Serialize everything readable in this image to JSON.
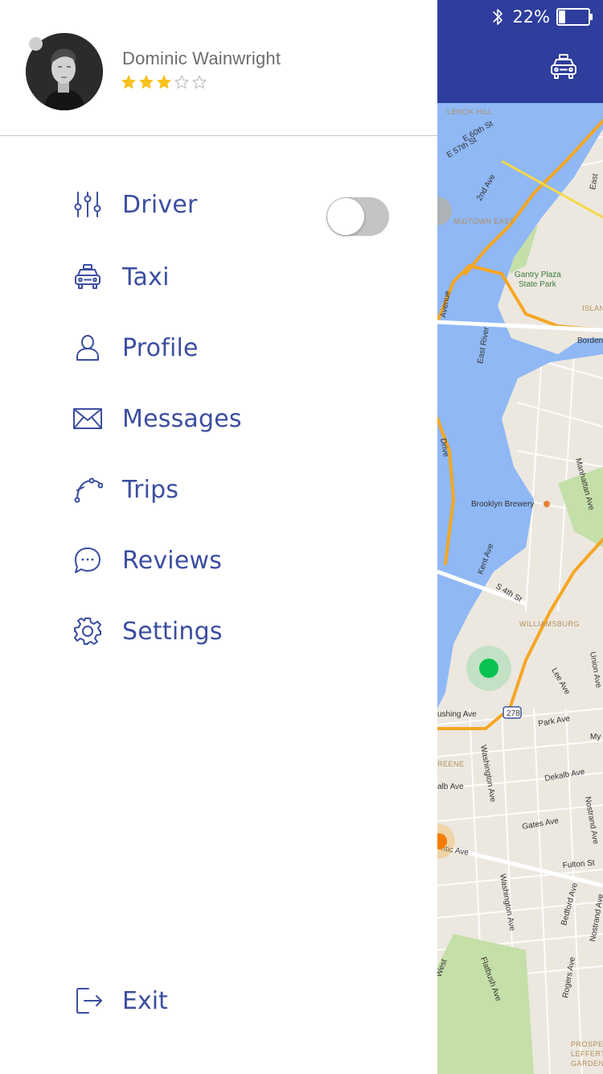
{
  "status_bar": {
    "battery_percent": "22%",
    "battery_level": 0.22
  },
  "user": {
    "name": "Dominic Wainwright",
    "rating": 3,
    "rating_max": 5,
    "star_color": "#f8c21c"
  },
  "menu": {
    "driver": {
      "label": "Driver",
      "icon": "sliders-icon",
      "toggle_on": false
    },
    "taxi": {
      "label": "Taxi",
      "icon": "taxi-icon"
    },
    "profile": {
      "label": "Profile",
      "icon": "person-icon"
    },
    "messages": {
      "label": "Messages",
      "icon": "envelope-icon"
    },
    "trips": {
      "label": "Trips",
      "icon": "route-icon"
    },
    "reviews": {
      "label": "Reviews",
      "icon": "chat-bubble-icon"
    },
    "settings": {
      "label": "Settings",
      "icon": "gear-icon"
    }
  },
  "exit": {
    "label": "Exit",
    "icon": "exit-icon"
  },
  "map": {
    "labels": {
      "e60": "E 60th St",
      "e57": "E 57th St",
      "ave2": "2nd Ave",
      "midtown": "MIDTOWN EAST",
      "gantry1": "Gantry Plaza",
      "gantry2": "State Park",
      "island": "ISLAN",
      "east_river": "East River",
      "borden": "Borden",
      "avenue": "Avenue",
      "drive": "Drive",
      "manhattan_ave": "Manhattan Ave",
      "brewery": "Brooklyn Brewery",
      "kent": "Kent Ave",
      "s4th": "S 4th St",
      "williamsburg": "WILLIAMSBURG",
      "lee": "Lee Ave",
      "union": "Union Ave",
      "i278": "278",
      "flushing": "ushing Ave",
      "park": "Park Ave",
      "my": "My",
      "greene": "REENE",
      "dekalb_left": "alb Ave",
      "washington": "Washington Ave",
      "dekalb": "Dekalb Ave",
      "nostrand": "Nostrand Ave",
      "gates": "Gates Ave",
      "atlantic": "ntic Ave",
      "fulton": "Fulton St",
      "washington2": "Washington Ave",
      "bedford": "Bedford Ave",
      "nostrand2": "Nostrand Ave",
      "west": "West",
      "flatbush": "Flatbush Ave",
      "rogers": "Rogers Ave",
      "prospect1": "PROSPEC",
      "prospect2": "LEFFERT",
      "prospect3": "GARDEN",
      "east": "East",
      "lexington": "LENOX HILL"
    },
    "colors": {
      "water": "#8fb8f5",
      "highway": "#f5a623",
      "park": "#c5dfa8",
      "current_location": "#0ac24f",
      "header": "#2f3d9c"
    }
  }
}
